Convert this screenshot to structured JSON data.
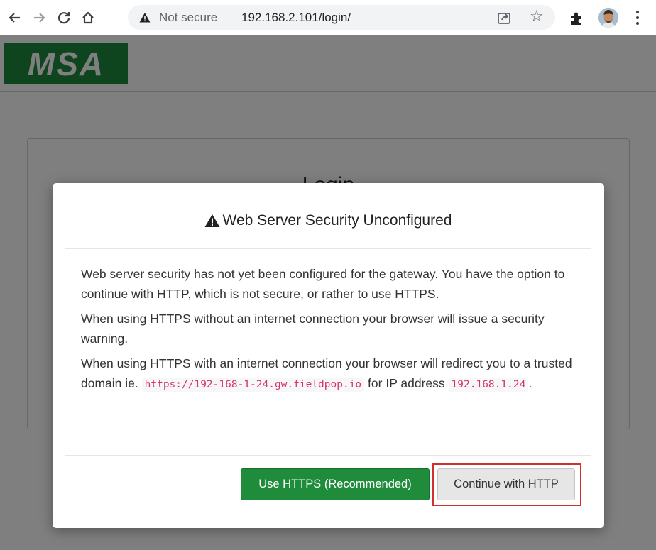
{
  "browser": {
    "security_label": "Not secure",
    "url": "192.168.2.101/login/",
    "icons": [
      "back-arrow-icon",
      "forward-arrow-icon",
      "reload-icon",
      "home-icon",
      "warning-icon",
      "share-icon",
      "star-icon",
      "extensions-icon",
      "avatar",
      "kebab-menu-icon"
    ]
  },
  "site": {
    "logo_text": "MSA",
    "brand_color": "#1f8a3c",
    "login_title": "Login"
  },
  "modal": {
    "title": "Web Server Security Unconfigured",
    "para1": "Web server security has not yet been configured for the gateway. You have the option to continue with HTTP, which is not secure, or rather to use HTTPS.",
    "para2": "When using HTTPS without an internet connection your browser will issue a security warning.",
    "para3_prefix": "When using HTTPS with an internet connection your browser will redirect you to a trusted domain ie.",
    "para3_domain": "https://192-168-1-24.gw.fieldpop.io",
    "para3_middle": "for IP address",
    "para3_ip": "192.168.1.24",
    "para3_suffix": ".",
    "https_button": "Use HTTPS (Recommended)",
    "http_button": "Continue with HTTP",
    "primary_color": "#1e8c3a",
    "highlight_color": "#d32f2f"
  }
}
